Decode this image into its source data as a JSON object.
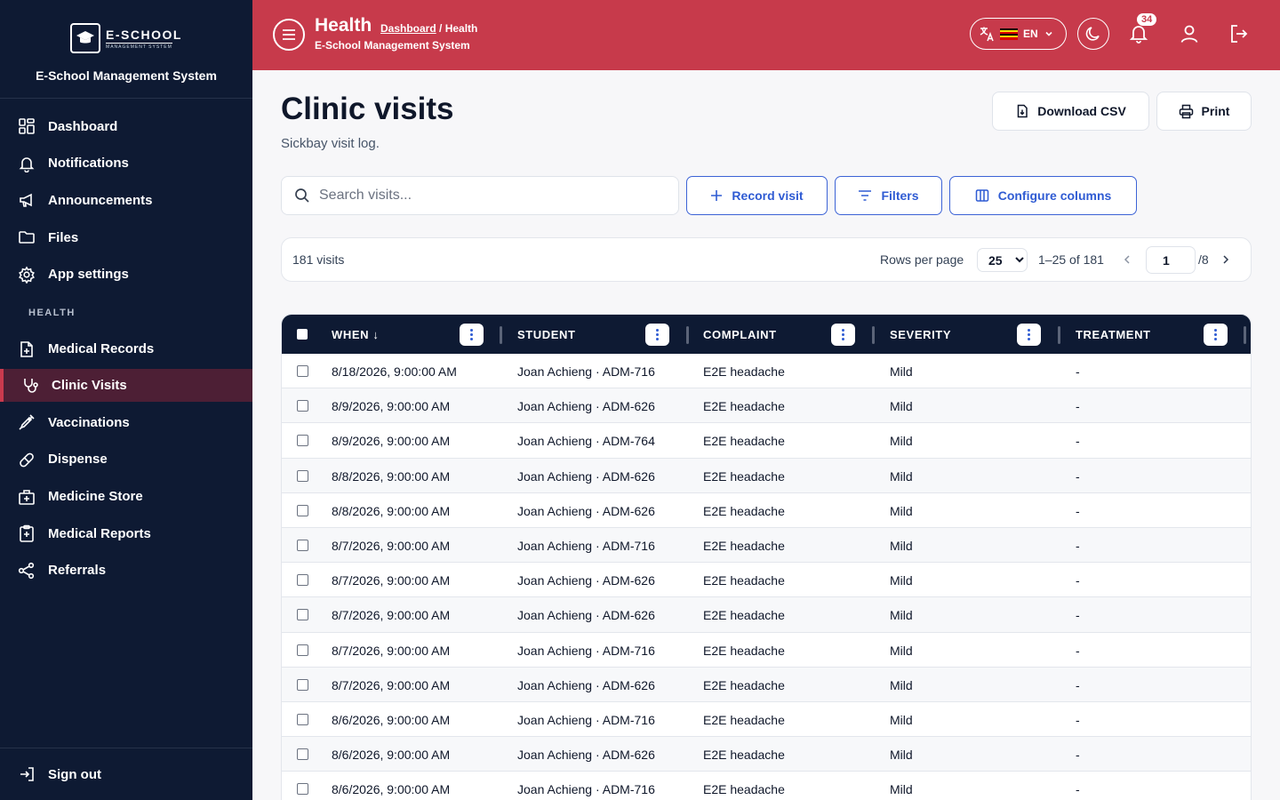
{
  "brand": {
    "logo_main": "E-SCHOOL",
    "logo_sub": "MANAGEMENT SYSTEM",
    "name": "E-School Management System"
  },
  "sidebar": {
    "items": [
      {
        "label": "Dashboard",
        "icon": "dashboard-icon"
      },
      {
        "label": "Notifications",
        "icon": "bell-icon"
      },
      {
        "label": "Announcements",
        "icon": "megaphone-icon"
      },
      {
        "label": "Files",
        "icon": "folder-icon"
      },
      {
        "label": "App settings",
        "icon": "gear-icon"
      }
    ],
    "section": "HEALTH",
    "health_items": [
      {
        "label": "Medical Records",
        "icon": "medical-file-icon"
      },
      {
        "label": "Clinic Visits",
        "icon": "stethoscope-icon",
        "active": true
      },
      {
        "label": "Vaccinations",
        "icon": "syringe-icon"
      },
      {
        "label": "Dispense",
        "icon": "pill-icon"
      },
      {
        "label": "Medicine Store",
        "icon": "medicine-box-icon"
      },
      {
        "label": "Medical Reports",
        "icon": "clipboard-plus-icon"
      },
      {
        "label": "Referrals",
        "icon": "share-icon"
      }
    ],
    "signout": "Sign out"
  },
  "topbar": {
    "title": "Health",
    "crumb_link": "Dashboard",
    "crumb_rest": " / Health",
    "subtitle": "E-School Management System",
    "lang": "EN",
    "notif_count": "34",
    "accent": "#c73a4b"
  },
  "page": {
    "title": "Clinic visits",
    "subtitle": "Sickbay visit log.",
    "download_label": "Download CSV",
    "print_label": "Print",
    "search_placeholder": "Search visits...",
    "record_label": "Record visit",
    "filters_label": "Filters",
    "configure_label": "Configure columns"
  },
  "pager": {
    "count": "181 visits",
    "rows_label": "Rows per page",
    "rows_value": "25",
    "range": "1–25 of 181",
    "page": "1",
    "pages": "/8"
  },
  "table": {
    "columns": [
      "WHEN ↓",
      "STUDENT",
      "COMPLAINT",
      "SEVERITY",
      "TREATMENT"
    ],
    "rows": [
      [
        "8/18/2026, 9:00:00 AM",
        "Joan Achieng · ADM-716",
        "E2E headache",
        "Mild",
        "-"
      ],
      [
        "8/9/2026, 9:00:00 AM",
        "Joan Achieng · ADM-626",
        "E2E headache",
        "Mild",
        "-"
      ],
      [
        "8/9/2026, 9:00:00 AM",
        "Joan Achieng · ADM-764",
        "E2E headache",
        "Mild",
        "-"
      ],
      [
        "8/8/2026, 9:00:00 AM",
        "Joan Achieng · ADM-626",
        "E2E headache",
        "Mild",
        "-"
      ],
      [
        "8/8/2026, 9:00:00 AM",
        "Joan Achieng · ADM-626",
        "E2E headache",
        "Mild",
        "-"
      ],
      [
        "8/7/2026, 9:00:00 AM",
        "Joan Achieng · ADM-716",
        "E2E headache",
        "Mild",
        "-"
      ],
      [
        "8/7/2026, 9:00:00 AM",
        "Joan Achieng · ADM-626",
        "E2E headache",
        "Mild",
        "-"
      ],
      [
        "8/7/2026, 9:00:00 AM",
        "Joan Achieng · ADM-626",
        "E2E headache",
        "Mild",
        "-"
      ],
      [
        "8/7/2026, 9:00:00 AM",
        "Joan Achieng · ADM-716",
        "E2E headache",
        "Mild",
        "-"
      ],
      [
        "8/7/2026, 9:00:00 AM",
        "Joan Achieng · ADM-626",
        "E2E headache",
        "Mild",
        "-"
      ],
      [
        "8/6/2026, 9:00:00 AM",
        "Joan Achieng · ADM-716",
        "E2E headache",
        "Mild",
        "-"
      ],
      [
        "8/6/2026, 9:00:00 AM",
        "Joan Achieng · ADM-626",
        "E2E headache",
        "Mild",
        "-"
      ],
      [
        "8/6/2026, 9:00:00 AM",
        "Joan Achieng · ADM-716",
        "E2E headache",
        "Mild",
        "-"
      ]
    ]
  }
}
